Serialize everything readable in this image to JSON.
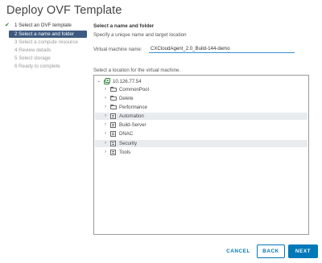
{
  "dialog": {
    "title": "Deploy OVF Template"
  },
  "steps": [
    {
      "label": "1 Select an OVF template",
      "state": "done"
    },
    {
      "label": "2 Select a name and folder",
      "state": "active"
    },
    {
      "label": "3 Select a compute resource",
      "state": "pending"
    },
    {
      "label": "4 Review details",
      "state": "pending"
    },
    {
      "label": "5 Select storage",
      "state": "pending"
    },
    {
      "label": "6 Ready to complete",
      "state": "pending"
    }
  ],
  "main": {
    "heading": "Select a name and folder",
    "subheading": "Specify a unique name and target location",
    "vm_name_label": "Virtual machine name:",
    "vm_name_value": "CXCloudAgent_2.0_Build-144-demo",
    "location_label": "Select a location for the virtual machine."
  },
  "tree": {
    "root": {
      "label": "10.126.77.54",
      "icon": "vcenter-icon",
      "expanded": true
    },
    "children": [
      {
        "label": "CommonPool",
        "icon": "folder-icon",
        "highlighted": false
      },
      {
        "label": "Delete",
        "icon": "folder-icon",
        "highlighted": false
      },
      {
        "label": "Performance",
        "icon": "folder-icon",
        "highlighted": false
      },
      {
        "label": "Automation",
        "icon": "datacenter-icon",
        "highlighted": true
      },
      {
        "label": "Build-Server",
        "icon": "datacenter-icon",
        "highlighted": false
      },
      {
        "label": "DNAC",
        "icon": "datacenter-icon",
        "highlighted": false
      },
      {
        "label": "Security",
        "icon": "datacenter-icon",
        "highlighted": true
      },
      {
        "label": "Tools",
        "icon": "datacenter-icon",
        "highlighted": false
      }
    ]
  },
  "footer": {
    "cancel_label": "CANCEL",
    "back_label": "BACK",
    "next_label": "NEXT"
  },
  "colors": {
    "accent": "#0079b8",
    "active_step": "#3d5a80",
    "check": "#2e7d32",
    "row_highlight": "#e9ecef"
  }
}
